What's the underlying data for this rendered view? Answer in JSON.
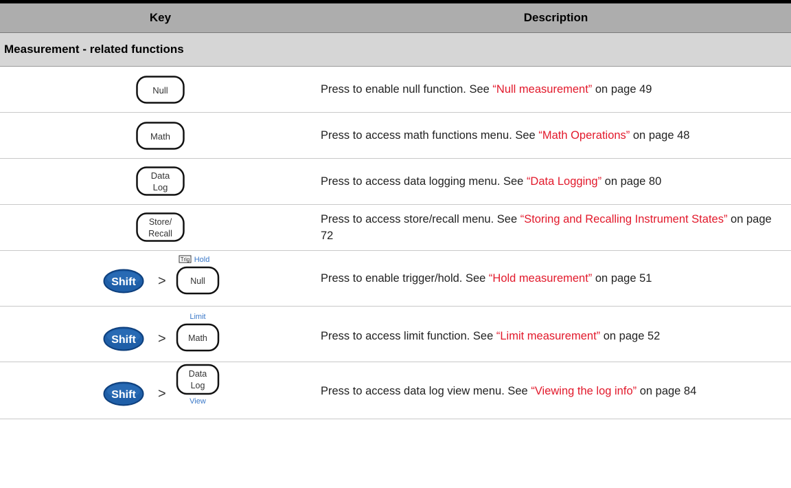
{
  "table": {
    "headers": {
      "key": "Key",
      "description": "Description"
    },
    "section_title": "Measurement - related functions",
    "rows": [
      {
        "key": {
          "label": "Null"
        },
        "desc": {
          "pre": "Press to enable null function. See ",
          "link": "“Null measurement”",
          "post": " on page 49"
        }
      },
      {
        "key": {
          "label": "Math"
        },
        "desc": {
          "pre": "Press to access math functions menu. See ",
          "link": "“Math Operations”",
          "post": " on page 48"
        }
      },
      {
        "key": {
          "line1": "Data",
          "line2": "Log"
        },
        "desc": {
          "pre": "Press to access data logging menu. See ",
          "link": "“Data Logging”",
          "post": " on page 80"
        }
      },
      {
        "key": {
          "line1": "Store/",
          "line2": "Recall"
        },
        "desc": {
          "pre": "Press to access store/recall menu. See ",
          "link": "“Storing and Recalling Instrument States”",
          "post": " on page 72"
        }
      },
      {
        "key": {
          "shift": "Shift",
          "arrow": ">",
          "box_label": "Trig",
          "top_label": "Hold",
          "label": "Null"
        },
        "desc": {
          "pre": "Press to enable trigger/hold. See ",
          "link": "“Hold measurement”",
          "post": " on page 51"
        }
      },
      {
        "key": {
          "shift": "Shift",
          "arrow": ">",
          "top_label": "Limit",
          "label": "Math"
        },
        "desc": {
          "pre": "Press to access limit function. See ",
          "link": "“Limit measurement”",
          "post": " on page 52"
        }
      },
      {
        "key": {
          "shift": "Shift",
          "arrow": ">",
          "line1": "Data",
          "line2": "Log",
          "bottom_label": "View"
        },
        "desc": {
          "pre": "Press to access data log view menu. See ",
          "link": "“Viewing the log info”",
          "post": " on page 84"
        }
      }
    ]
  },
  "colors": {
    "link": "#e2192b",
    "shift_key": "#1f5fa8",
    "shift_label_blue": "#3a78c8",
    "header_bg": "#adadad",
    "section_bg": "#d6d6d6"
  }
}
